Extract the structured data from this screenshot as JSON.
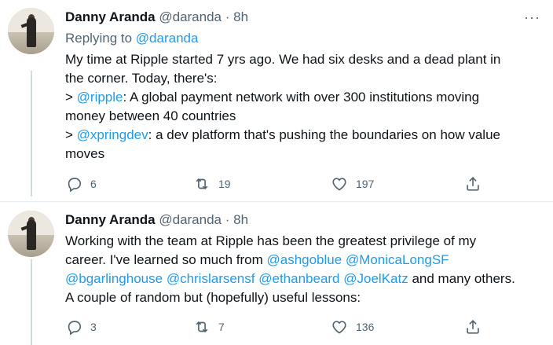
{
  "tweets": [
    {
      "author": "Danny Aranda",
      "handle": "@daranda",
      "separator": "·",
      "time": "8h",
      "more": "···",
      "reply_prefix": "Replying to",
      "reply_handle": "@daranda",
      "lines": [
        "My time at Ripple started 7 yrs ago.  We had six desks and a dead plant in",
        "the corner.  Today, there's:",
        "> ",
        "@ripple",
        ": A global payment network with over 300 institutions moving",
        "money between 40 countries",
        "> ",
        "@xpringdev",
        ": a dev platform that's pushing the boundaries on how value",
        "moves"
      ],
      "replies": "6",
      "retweets": "19",
      "likes": "197"
    },
    {
      "author": "Danny Aranda",
      "handle": "@daranda",
      "separator": "·",
      "time": "8h",
      "lines": [
        "Working with the team at Ripple has been the greatest privilege of my",
        "career.  I've learned so much from ",
        "@ashgoblue",
        " ",
        "@MonicaLongSF",
        "@bgarlinghouse",
        " ",
        "@chrislarsensf",
        " ",
        "@ethanbeard",
        " ",
        "@JoelKatz",
        " and many others.",
        "A couple of random but (hopefully) useful lessons:"
      ],
      "replies": "3",
      "retweets": "7",
      "likes": "136"
    }
  ],
  "icons": {
    "reply": "reply-icon",
    "retweet": "retweet-icon",
    "like": "heart-icon",
    "share": "share-icon"
  },
  "colors": {
    "link": "#1d9bf0",
    "muted": "#536471",
    "text": "#0f1419",
    "thread_line": "#cfd9de"
  }
}
